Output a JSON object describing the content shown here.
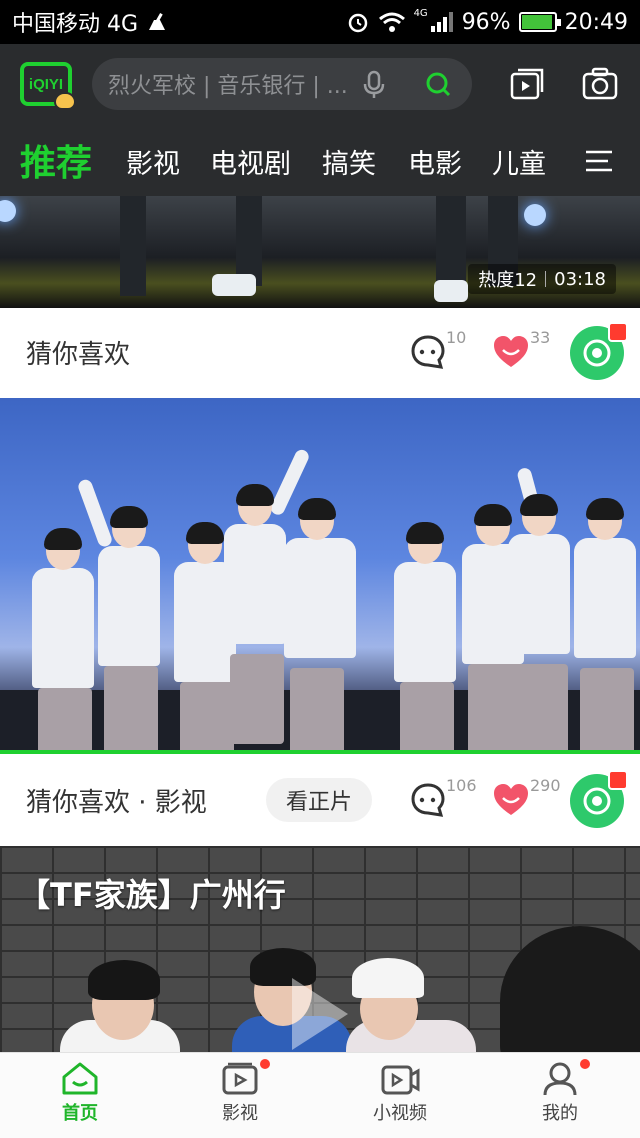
{
  "status_bar": {
    "carrier": "中国移动 4G",
    "network_small": "4G",
    "battery": "96%",
    "time": "20:49"
  },
  "header": {
    "logo_text": "iQIYI",
    "search_placeholder": "烈火军校 | 音乐银行 | ...",
    "tabs": [
      {
        "label": "推荐",
        "active": true
      },
      {
        "label": "影视"
      },
      {
        "label": "电视剧"
      },
      {
        "label": "搞笑"
      },
      {
        "label": "电影"
      },
      {
        "label": "儿童"
      }
    ]
  },
  "feed": [
    {
      "heat_label": "热度12",
      "duration": "03:18",
      "category": "猜你喜欢",
      "comments": "10",
      "likes": "33"
    },
    {
      "category": "猜你喜欢 · 影视",
      "watch_button": "看正片",
      "comments": "106",
      "likes": "290"
    },
    {
      "title": "【TF家族】广州行"
    }
  ],
  "bottom_nav": [
    {
      "label": "首页",
      "icon": "home-icon",
      "active": true
    },
    {
      "label": "影视",
      "icon": "tv-icon",
      "badge": true
    },
    {
      "label": "小视频",
      "icon": "short-video-icon"
    },
    {
      "label": "我的",
      "icon": "profile-icon",
      "badge": true
    }
  ],
  "colors": {
    "accent": "#1fd030",
    "header_bg": "#2a2c2e",
    "like": "#f2546a",
    "badge": "#ff3b2f"
  }
}
